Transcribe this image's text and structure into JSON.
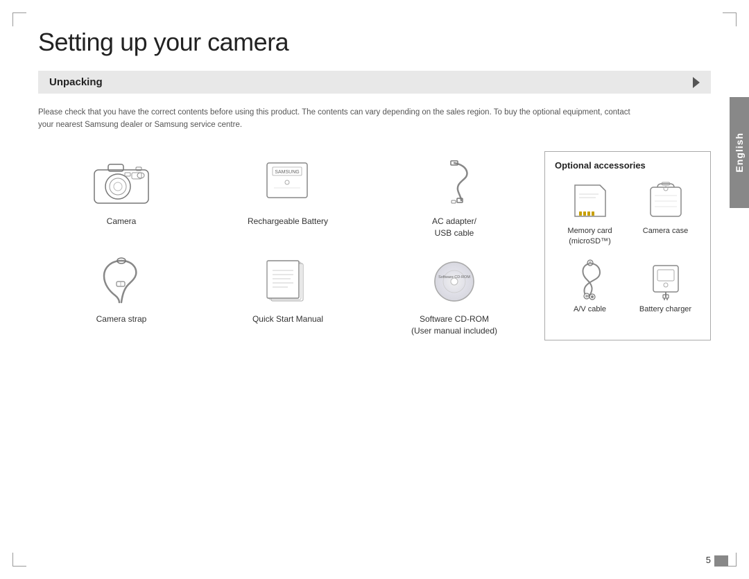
{
  "page": {
    "title": "Setting up your camera",
    "page_number": "5",
    "section": "Unpacking",
    "description": "Please check that you have the correct contents before using this product. The contents can vary depending on the sales region.\nTo buy the optional equipment, contact your nearest Samsung dealer or Samsung service centre.",
    "side_tab_label": "English"
  },
  "included_items": [
    {
      "id": "camera",
      "label": "Camera"
    },
    {
      "id": "rechargeable-battery",
      "label": "Rechargeable Battery"
    },
    {
      "id": "ac-adapter",
      "label": "AC adapter/\nUSB cable"
    },
    {
      "id": "camera-strap",
      "label": "Camera strap"
    },
    {
      "id": "quick-start-manual",
      "label": "Quick Start Manual"
    },
    {
      "id": "software-cd-rom",
      "label": "Software CD-ROM\n(User manual included)"
    }
  ],
  "optional_accessories": {
    "title": "Optional accessories",
    "items": [
      {
        "id": "memory-card",
        "label": "Memory card\n(microSD™)"
      },
      {
        "id": "camera-case",
        "label": "Camera case"
      },
      {
        "id": "av-cable",
        "label": "A/V cable"
      },
      {
        "id": "battery-charger",
        "label": "Battery charger"
      }
    ]
  }
}
